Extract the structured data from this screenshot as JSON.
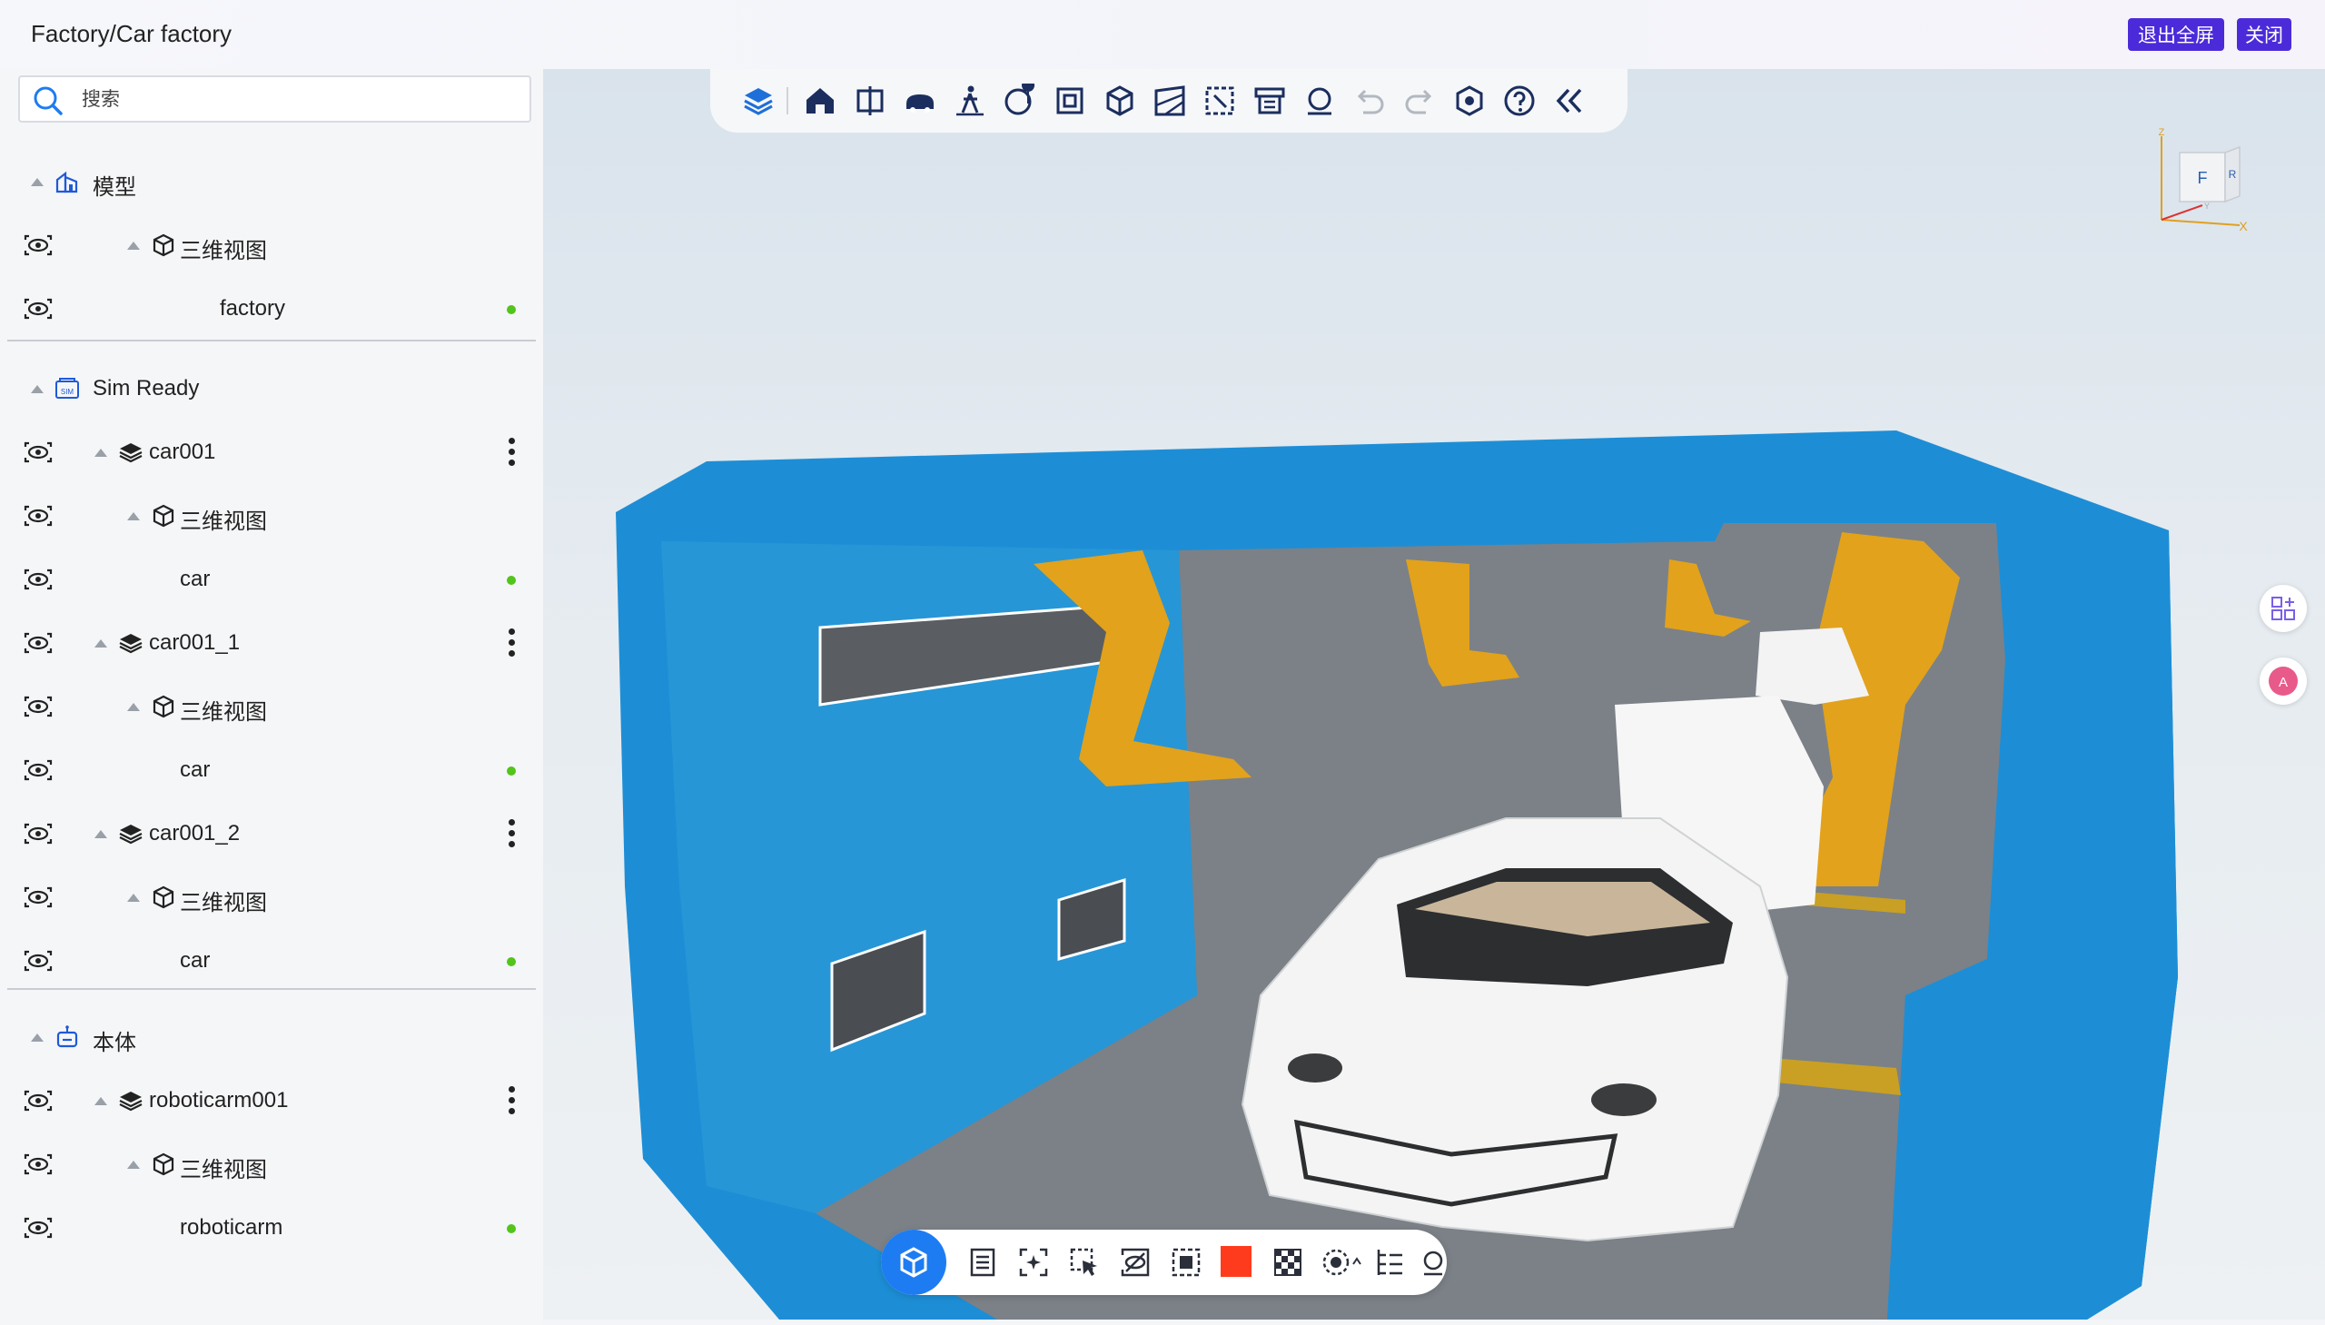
{
  "header": {
    "title": "Factory/Car factory",
    "exit_fullscreen_label": "退出全屏",
    "close_label": "关闭"
  },
  "search": {
    "placeholder": "搜索"
  },
  "tree": {
    "model": {
      "label": "模型",
      "view_label": "三维视图",
      "factory_label": "factory"
    },
    "sim_ready": {
      "label": "Sim Ready",
      "items": [
        {
          "label": "car001",
          "view_label": "三维视图",
          "leaf_label": "car"
        },
        {
          "label": "car001_1",
          "view_label": "三维视图",
          "leaf_label": "car"
        },
        {
          "label": "car001_2",
          "view_label": "三维视图",
          "leaf_label": "car"
        }
      ]
    },
    "body": {
      "label": "本体",
      "item": {
        "label": "roboticarm001",
        "view_label": "三维视图",
        "leaf_label": "roboticarm"
      }
    }
  },
  "top_toolbar": {
    "icons": [
      "layers-icon",
      "home-icon",
      "section-icon",
      "vehicle-icon",
      "walk-icon",
      "globe-pin-icon",
      "fit-view-icon",
      "cube-view-icon",
      "measure-plane-icon",
      "select-box-icon",
      "clear-icon",
      "rotate-icon",
      "undo-icon",
      "redo-icon",
      "settings-icon",
      "help-icon",
      "collapse-icon"
    ]
  },
  "bottom_toolbar": {
    "icons": [
      "cube-icon",
      "list-icon",
      "focus-icon",
      "pointer-select-icon",
      "hide-icon",
      "frame-select-icon",
      "color-swatch-icon",
      "checker-icon",
      "orbit-icon",
      "tree-icon",
      "reset-icon"
    ],
    "swatch_color": "#ff3b1d"
  },
  "navcube": {
    "front_label": "F",
    "right_label": "R",
    "x_label": "X",
    "z_label": "Z",
    "y_label": "Y"
  },
  "colors": {
    "accent": "#4b2bd9",
    "status_green": "#52c41a",
    "primary_blue": "#1e7cf2"
  }
}
